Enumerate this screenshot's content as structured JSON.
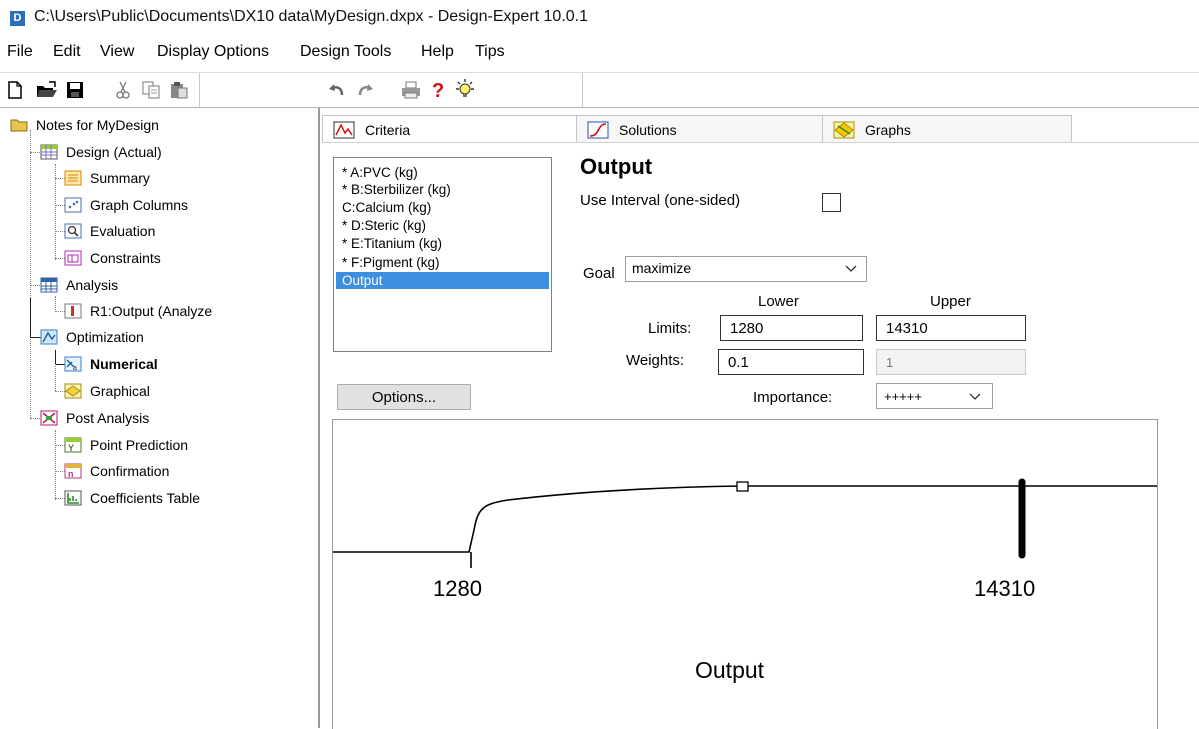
{
  "window": {
    "title": "C:\\Users\\Public\\Documents\\DX10 data\\MyDesign.dxpx - Design-Expert 10.0.1",
    "app_icon_text": "D"
  },
  "menu": [
    "File",
    "Edit",
    "View",
    "Display Options",
    "Design Tools",
    "Help",
    "Tips"
  ],
  "toolbar": {
    "icons": [
      "new-icon",
      "open-icon",
      "save-icon",
      "cut-icon",
      "copy-icon",
      "paste-icon",
      "undo-icon",
      "redo-icon",
      "print-icon",
      "help-icon",
      "tip-icon"
    ]
  },
  "tree": {
    "root": "Notes for MyDesign",
    "design": "Design (Actual)",
    "summary": "Summary",
    "graph_columns": "Graph Columns",
    "evaluation": "Evaluation",
    "constraints": "Constraints",
    "analysis": "Analysis",
    "r1_output": "R1:Output (Analyze",
    "optimization": "Optimization",
    "numerical": "Numerical",
    "graphical": "Graphical",
    "post_analysis": "Post Analysis",
    "point_prediction": "Point Prediction",
    "confirmation": "Confirmation",
    "coefficients_table": "Coefficients Table"
  },
  "tabs": {
    "criteria": "Criteria",
    "solutions": "Solutions",
    "graphs": "Graphs",
    "active": "Criteria"
  },
  "criteria_list": {
    "items": [
      "* A:PVC (kg)",
      "* B:Sterbilizer (kg)",
      "C:Calcium (kg)",
      "* D:Steric (kg)",
      "* E:Titanium (kg)",
      "* F:Pigment (kg)",
      "Output"
    ],
    "selected": "Output"
  },
  "form": {
    "title": "Output",
    "use_interval_label": "Use Interval (one-sided)",
    "use_interval_checked": false,
    "goal_label": "Goal",
    "goal_value": "maximize",
    "lower_header": "Lower",
    "upper_header": "Upper",
    "limits_label": "Limits:",
    "lower_limit": "1280",
    "upper_limit": "14310",
    "weights_label": "Weights:",
    "lower_weight": "0.1",
    "upper_weight": "1",
    "options_button": "Options...",
    "importance_label": "Importance:",
    "importance_value": "+++++"
  },
  "graph": {
    "lower_tick": "1280",
    "upper_tick": "14310",
    "axis_title": "Output"
  }
}
